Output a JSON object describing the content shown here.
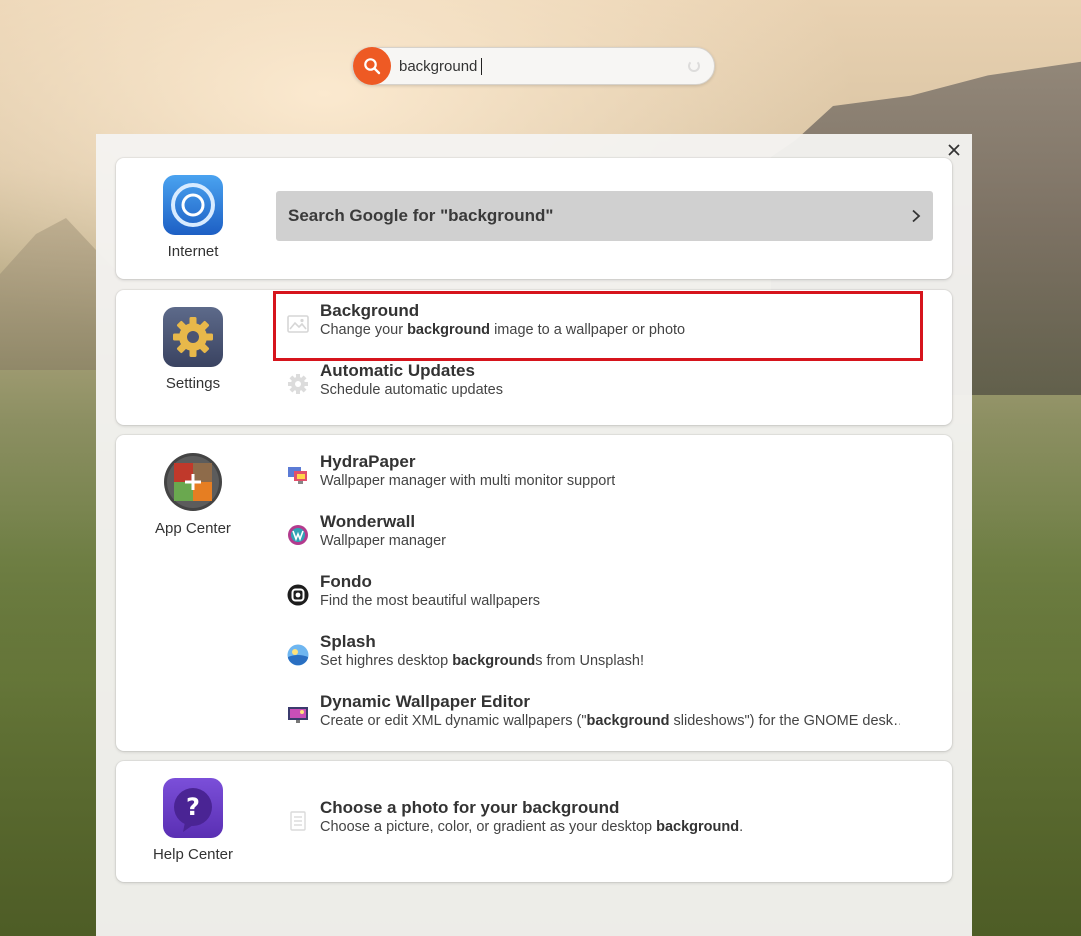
{
  "search": {
    "value": "background",
    "placeholder": "Search"
  },
  "close_label": "×",
  "internet": {
    "app_label": "Internet",
    "google_label": "Search Google for \"background\""
  },
  "settings": {
    "app_label": "Settings",
    "results": [
      {
        "title": "Background",
        "desc_pre": "Change your ",
        "desc_bold": "background",
        "desc_post": " image to a wallpaper or photo"
      },
      {
        "title": "Automatic Updates",
        "desc": "Schedule automatic updates"
      }
    ]
  },
  "app_center": {
    "app_label": "App Center",
    "results": [
      {
        "title": "HydraPaper",
        "desc": "Wallpaper manager with multi monitor support"
      },
      {
        "title": "Wonderwall",
        "desc": "Wallpaper manager"
      },
      {
        "title": "Fondo",
        "desc": "Find the most beautiful wallpapers"
      },
      {
        "title": "Splash",
        "desc_pre": "Set highres desktop ",
        "desc_bold": "background",
        "desc_post": "s from Unsplash!"
      },
      {
        "title": "Dynamic Wallpaper Editor",
        "desc_pre": "Create or edit XML dynamic wallpapers (\"",
        "desc_bold": "background",
        "desc_post": " slideshows\") for the GNOME desk…"
      }
    ]
  },
  "help_center": {
    "app_label": "Help Center",
    "results": [
      {
        "title": "Choose a photo for your background",
        "desc_pre": "Choose a picture, color, or gradient as your desktop ",
        "desc_bold": "background",
        "desc_post": "."
      }
    ]
  },
  "colors": {
    "search_accent": "#ee5a24",
    "highlight": "#d6141c",
    "google_button": "#d0d0d0"
  }
}
